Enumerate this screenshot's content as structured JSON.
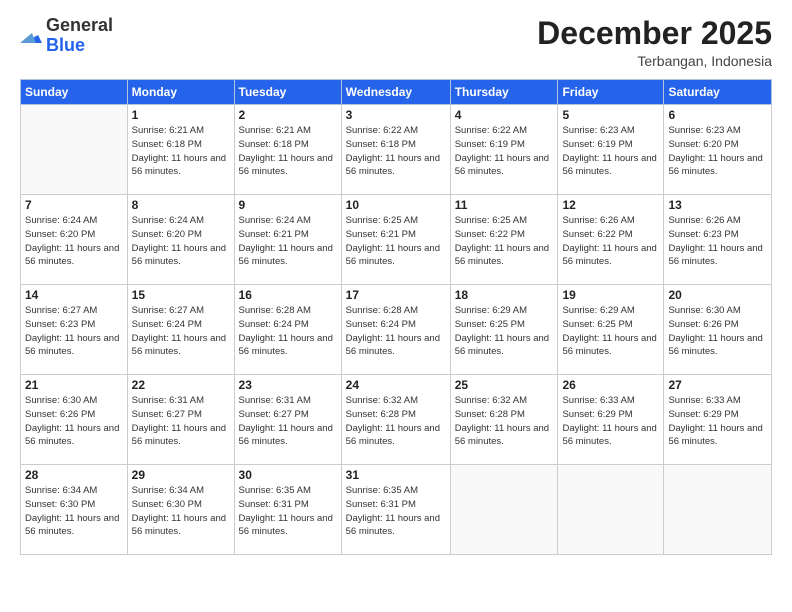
{
  "logo": {
    "general": "General",
    "blue": "Blue"
  },
  "title": {
    "month_year": "December 2025",
    "location": "Terbangan, Indonesia"
  },
  "weekdays": [
    "Sunday",
    "Monday",
    "Tuesday",
    "Wednesday",
    "Thursday",
    "Friday",
    "Saturday"
  ],
  "weeks": [
    [
      {
        "day": "",
        "sunrise": "",
        "sunset": "",
        "daylight": ""
      },
      {
        "day": "1",
        "sunrise": "Sunrise: 6:21 AM",
        "sunset": "Sunset: 6:18 PM",
        "daylight": "Daylight: 11 hours and 56 minutes."
      },
      {
        "day": "2",
        "sunrise": "Sunrise: 6:21 AM",
        "sunset": "Sunset: 6:18 PM",
        "daylight": "Daylight: 11 hours and 56 minutes."
      },
      {
        "day": "3",
        "sunrise": "Sunrise: 6:22 AM",
        "sunset": "Sunset: 6:18 PM",
        "daylight": "Daylight: 11 hours and 56 minutes."
      },
      {
        "day": "4",
        "sunrise": "Sunrise: 6:22 AM",
        "sunset": "Sunset: 6:19 PM",
        "daylight": "Daylight: 11 hours and 56 minutes."
      },
      {
        "day": "5",
        "sunrise": "Sunrise: 6:23 AM",
        "sunset": "Sunset: 6:19 PM",
        "daylight": "Daylight: 11 hours and 56 minutes."
      },
      {
        "day": "6",
        "sunrise": "Sunrise: 6:23 AM",
        "sunset": "Sunset: 6:20 PM",
        "daylight": "Daylight: 11 hours and 56 minutes."
      }
    ],
    [
      {
        "day": "7",
        "sunrise": "Sunrise: 6:24 AM",
        "sunset": "Sunset: 6:20 PM",
        "daylight": "Daylight: 11 hours and 56 minutes."
      },
      {
        "day": "8",
        "sunrise": "Sunrise: 6:24 AM",
        "sunset": "Sunset: 6:20 PM",
        "daylight": "Daylight: 11 hours and 56 minutes."
      },
      {
        "day": "9",
        "sunrise": "Sunrise: 6:24 AM",
        "sunset": "Sunset: 6:21 PM",
        "daylight": "Daylight: 11 hours and 56 minutes."
      },
      {
        "day": "10",
        "sunrise": "Sunrise: 6:25 AM",
        "sunset": "Sunset: 6:21 PM",
        "daylight": "Daylight: 11 hours and 56 minutes."
      },
      {
        "day": "11",
        "sunrise": "Sunrise: 6:25 AM",
        "sunset": "Sunset: 6:22 PM",
        "daylight": "Daylight: 11 hours and 56 minutes."
      },
      {
        "day": "12",
        "sunrise": "Sunrise: 6:26 AM",
        "sunset": "Sunset: 6:22 PM",
        "daylight": "Daylight: 11 hours and 56 minutes."
      },
      {
        "day": "13",
        "sunrise": "Sunrise: 6:26 AM",
        "sunset": "Sunset: 6:23 PM",
        "daylight": "Daylight: 11 hours and 56 minutes."
      }
    ],
    [
      {
        "day": "14",
        "sunrise": "Sunrise: 6:27 AM",
        "sunset": "Sunset: 6:23 PM",
        "daylight": "Daylight: 11 hours and 56 minutes."
      },
      {
        "day": "15",
        "sunrise": "Sunrise: 6:27 AM",
        "sunset": "Sunset: 6:24 PM",
        "daylight": "Daylight: 11 hours and 56 minutes."
      },
      {
        "day": "16",
        "sunrise": "Sunrise: 6:28 AM",
        "sunset": "Sunset: 6:24 PM",
        "daylight": "Daylight: 11 hours and 56 minutes."
      },
      {
        "day": "17",
        "sunrise": "Sunrise: 6:28 AM",
        "sunset": "Sunset: 6:24 PM",
        "daylight": "Daylight: 11 hours and 56 minutes."
      },
      {
        "day": "18",
        "sunrise": "Sunrise: 6:29 AM",
        "sunset": "Sunset: 6:25 PM",
        "daylight": "Daylight: 11 hours and 56 minutes."
      },
      {
        "day": "19",
        "sunrise": "Sunrise: 6:29 AM",
        "sunset": "Sunset: 6:25 PM",
        "daylight": "Daylight: 11 hours and 56 minutes."
      },
      {
        "day": "20",
        "sunrise": "Sunrise: 6:30 AM",
        "sunset": "Sunset: 6:26 PM",
        "daylight": "Daylight: 11 hours and 56 minutes."
      }
    ],
    [
      {
        "day": "21",
        "sunrise": "Sunrise: 6:30 AM",
        "sunset": "Sunset: 6:26 PM",
        "daylight": "Daylight: 11 hours and 56 minutes."
      },
      {
        "day": "22",
        "sunrise": "Sunrise: 6:31 AM",
        "sunset": "Sunset: 6:27 PM",
        "daylight": "Daylight: 11 hours and 56 minutes."
      },
      {
        "day": "23",
        "sunrise": "Sunrise: 6:31 AM",
        "sunset": "Sunset: 6:27 PM",
        "daylight": "Daylight: 11 hours and 56 minutes."
      },
      {
        "day": "24",
        "sunrise": "Sunrise: 6:32 AM",
        "sunset": "Sunset: 6:28 PM",
        "daylight": "Daylight: 11 hours and 56 minutes."
      },
      {
        "day": "25",
        "sunrise": "Sunrise: 6:32 AM",
        "sunset": "Sunset: 6:28 PM",
        "daylight": "Daylight: 11 hours and 56 minutes."
      },
      {
        "day": "26",
        "sunrise": "Sunrise: 6:33 AM",
        "sunset": "Sunset: 6:29 PM",
        "daylight": "Daylight: 11 hours and 56 minutes."
      },
      {
        "day": "27",
        "sunrise": "Sunrise: 6:33 AM",
        "sunset": "Sunset: 6:29 PM",
        "daylight": "Daylight: 11 hours and 56 minutes."
      }
    ],
    [
      {
        "day": "28",
        "sunrise": "Sunrise: 6:34 AM",
        "sunset": "Sunset: 6:30 PM",
        "daylight": "Daylight: 11 hours and 56 minutes."
      },
      {
        "day": "29",
        "sunrise": "Sunrise: 6:34 AM",
        "sunset": "Sunset: 6:30 PM",
        "daylight": "Daylight: 11 hours and 56 minutes."
      },
      {
        "day": "30",
        "sunrise": "Sunrise: 6:35 AM",
        "sunset": "Sunset: 6:31 PM",
        "daylight": "Daylight: 11 hours and 56 minutes."
      },
      {
        "day": "31",
        "sunrise": "Sunrise: 6:35 AM",
        "sunset": "Sunset: 6:31 PM",
        "daylight": "Daylight: 11 hours and 56 minutes."
      },
      {
        "day": "",
        "sunrise": "",
        "sunset": "",
        "daylight": ""
      },
      {
        "day": "",
        "sunrise": "",
        "sunset": "",
        "daylight": ""
      },
      {
        "day": "",
        "sunrise": "",
        "sunset": "",
        "daylight": ""
      }
    ]
  ]
}
